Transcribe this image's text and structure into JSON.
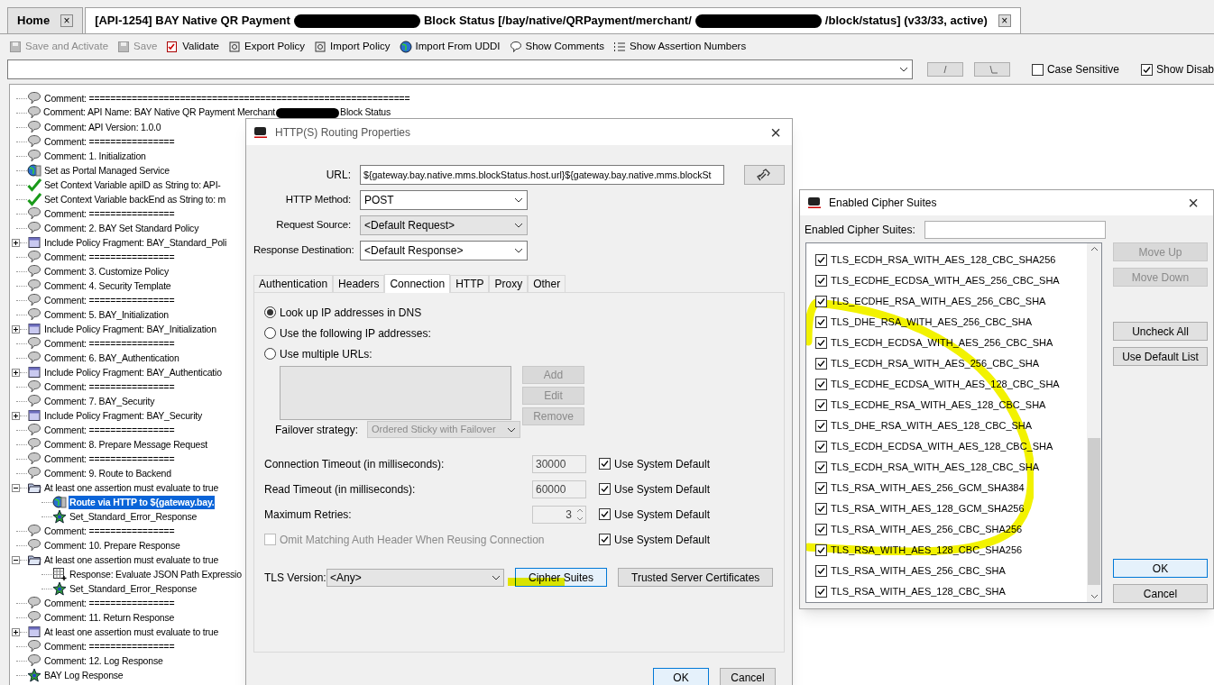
{
  "tabs": [
    {
      "title_parts": [
        "Home"
      ],
      "selected": false,
      "close": "×"
    },
    {
      "title_parts": [
        "[API-1254] BAY Native QR Payment",
        "Block Status [/bay/native/QRPayment/merchant/",
        "/block/status] (v33/33, active)"
      ],
      "selected": true,
      "close": "×"
    }
  ],
  "toolbar": [
    {
      "label": "Save and Activate",
      "kind": "save",
      "disabled": true
    },
    {
      "label": "Save",
      "kind": "save",
      "disabled": true
    },
    {
      "label": "Validate",
      "kind": "validate",
      "disabled": false
    },
    {
      "label": "Export Policy",
      "kind": "export",
      "disabled": false
    },
    {
      "label": "Import Policy",
      "kind": "export",
      "disabled": false
    },
    {
      "label": "Import From UDDI",
      "kind": "globe",
      "disabled": false
    },
    {
      "label": "Show Comments",
      "kind": "comment",
      "disabled": false
    },
    {
      "label": "Show Assertion Numbers",
      "kind": "numbers",
      "disabled": false
    }
  ],
  "search_options": [
    {
      "label": "Case Sensitive",
      "checked": false
    },
    {
      "label": "Show Disab",
      "checked": true
    }
  ],
  "tree": [
    {
      "kind": "comment",
      "text": "Comment: ============================================================",
      "selected": false
    },
    {
      "kind": "comment",
      "parts": [
        "Comment: API Name: BAY Native QR Payment Merchant",
        "Block Status"
      ],
      "selected": false
    },
    {
      "kind": "comment",
      "text": "Comment: API Version: 1.0.0",
      "selected": false
    },
    {
      "kind": "comment",
      "text": "Comment: ================",
      "selected": false
    },
    {
      "kind": "comment",
      "text": "Comment: 1. Initialization",
      "selected": false
    },
    {
      "kind": "globe",
      "text": "Set as Portal Managed Service",
      "selected": false
    },
    {
      "kind": "check",
      "text": "Set Context Variable apiID as String to: API-",
      "selected": false
    },
    {
      "kind": "check",
      "text": "Set Context Variable backEnd as String to: m",
      "selected": false
    },
    {
      "kind": "comment",
      "text": "Comment: ================",
      "selected": false
    },
    {
      "kind": "comment",
      "text": "Comment: 2. BAY Set Standard Policy",
      "selected": false
    },
    {
      "kind": "fragment",
      "text": "Include Policy Fragment: BAY_Standard_Poli",
      "selected": false,
      "expanded": false
    },
    {
      "kind": "comment",
      "text": "Comment: ================",
      "selected": false
    },
    {
      "kind": "comment",
      "text": "Comment: 3. Customize Policy",
      "selected": false
    },
    {
      "kind": "comment",
      "text": "Comment: 4. Security Template",
      "selected": false
    },
    {
      "kind": "comment",
      "text": "Comment: ================",
      "selected": false
    },
    {
      "kind": "comment",
      "text": "Comment: 5. BAY_Initialization",
      "selected": false
    },
    {
      "kind": "fragment",
      "text": "Include Policy Fragment: BAY_Initialization",
      "selected": false,
      "expanded": false
    },
    {
      "kind": "comment",
      "text": "Comment: ================",
      "selected": false
    },
    {
      "kind": "comment",
      "text": "Comment: 6. BAY_Authentication",
      "selected": false
    },
    {
      "kind": "fragment",
      "text": "Include Policy Fragment: BAY_Authenticatio",
      "selected": false,
      "expanded": false
    },
    {
      "kind": "comment",
      "text": "Comment: ================",
      "selected": false
    },
    {
      "kind": "comment",
      "text": "Comment: 7. BAY_Security",
      "selected": false
    },
    {
      "kind": "fragment",
      "text": "Include Policy Fragment: BAY_Security",
      "selected": false,
      "expanded": false
    },
    {
      "kind": "comment",
      "text": "Comment: ================",
      "selected": false
    },
    {
      "kind": "comment",
      "text": "Comment: 8. Prepare Message Request",
      "selected": false
    },
    {
      "kind": "comment",
      "text": "Comment: ================",
      "selected": false
    },
    {
      "kind": "comment",
      "text": "Comment: 9. Route to Backend",
      "selected": false
    },
    {
      "kind": "folder",
      "text": "At least one assertion must evaluate to true",
      "selected": false,
      "expanded": true,
      "children": [
        {
          "kind": "globe",
          "text": "Route via HTTP to ${gateway.bay.",
          "selected": true
        },
        {
          "kind": "star",
          "text": "Set_Standard_Error_Response",
          "selected": false
        }
      ]
    },
    {
      "kind": "comment",
      "text": "Comment: ================",
      "selected": false
    },
    {
      "kind": "comment",
      "text": "Comment: 10. Prepare Response",
      "selected": false
    },
    {
      "kind": "folder",
      "text": "At least one assertion must evaluate to true",
      "selected": false,
      "expanded": true,
      "children": [
        {
          "kind": "json",
          "text": "Response: Evaluate JSON Path Expressio",
          "selected": false
        },
        {
          "kind": "star",
          "text": "Set_Standard_Error_Response",
          "selected": false
        }
      ]
    },
    {
      "kind": "comment",
      "text": "Comment: ================",
      "selected": false
    },
    {
      "kind": "comment",
      "text": "Comment: 11. Return Response",
      "selected": false
    },
    {
      "kind": "fragment",
      "text": "At least one assertion must evaluate to true",
      "selected": false,
      "expanded": false
    },
    {
      "kind": "comment",
      "text": "Comment: ================",
      "selected": false
    },
    {
      "kind": "comment",
      "text": "Comment: 12. Log Response",
      "selected": false
    },
    {
      "kind": "star",
      "text": "BAY Log Response",
      "selected": false
    }
  ],
  "http_dialog": {
    "title": "HTTP(S) Routing Properties",
    "close": "×",
    "url": {
      "label": "URL:",
      "value": "${gateway.bay.native.mms.blockStatus.host.url}${gateway.bay.native.mms.blockSt"
    },
    "fields": [
      {
        "label": "HTTP Method:",
        "value": "POST",
        "disabled": false
      },
      {
        "label": "Request Source:",
        "value": "<Default Request>",
        "disabled": true
      },
      {
        "label": "Response Destination:",
        "value": "<Default Response>",
        "disabled": false
      }
    ],
    "tabs": [
      {
        "label": "Authentication",
        "selected": false
      },
      {
        "label": "Headers",
        "selected": false
      },
      {
        "label": "Connection",
        "selected": true
      },
      {
        "label": "HTTP",
        "selected": false
      },
      {
        "label": "Proxy",
        "selected": false
      },
      {
        "label": "Other",
        "selected": false
      }
    ],
    "radios": [
      {
        "label": "Look up IP addresses in DNS",
        "selected": true
      },
      {
        "label": "Use the following IP addresses:",
        "selected": false
      },
      {
        "label": "Use multiple URLs:",
        "selected": false
      }
    ],
    "list_buttons": [
      {
        "label": "Add",
        "disabled": true
      },
      {
        "label": "Edit",
        "disabled": true
      },
      {
        "label": "Remove",
        "disabled": true
      }
    ],
    "failover": {
      "label": "Failover strategy:",
      "value": "Ordered Sticky with Failover",
      "disabled": true
    },
    "settings": [
      {
        "kind": "input",
        "label": "Connection Timeout (in milliseconds):",
        "value": "30000",
        "disabled": true,
        "default_label": "Use System Default",
        "default_checked": true
      },
      {
        "kind": "input",
        "label": "Read Timeout (in milliseconds):",
        "value": "60000",
        "disabled": true,
        "default_label": "Use System Default",
        "default_checked": true
      },
      {
        "kind": "spinner",
        "label": "Maximum Retries:",
        "value": "3",
        "disabled": true,
        "default_label": "Use System Default",
        "default_checked": true
      },
      {
        "kind": "checkbox",
        "label": "Omit Matching Auth Header When Reusing Connection",
        "checked": false,
        "disabled": true,
        "default_label": "Use System Default",
        "default_checked": true
      }
    ],
    "tls": {
      "label": "TLS Version:",
      "value": "<Any>"
    },
    "tls_buttons": [
      {
        "label": "Cipher Suites",
        "focused": true
      },
      {
        "label": "Trusted Server Certificates",
        "focused": false
      }
    ],
    "footer_buttons": [
      {
        "label": "OK",
        "focused": true
      },
      {
        "label": "Cancel",
        "focused": false
      }
    ]
  },
  "cipher_dialog": {
    "title": "Enabled Cipher Suites",
    "close": "×",
    "filter_label": "Enabled Cipher Suites:",
    "suites": [
      {
        "label": "TLS_ECDH_RSA_WITH_AES_128_CBC_SHA256",
        "checked": true
      },
      {
        "label": "TLS_ECDHE_ECDSA_WITH_AES_256_CBC_SHA",
        "checked": true
      },
      {
        "label": "TLS_ECDHE_RSA_WITH_AES_256_CBC_SHA",
        "checked": true
      },
      {
        "label": "TLS_DHE_RSA_WITH_AES_256_CBC_SHA",
        "checked": true
      },
      {
        "label": "TLS_ECDH_ECDSA_WITH_AES_256_CBC_SHA",
        "checked": true
      },
      {
        "label": "TLS_ECDH_RSA_WITH_AES_256_CBC_SHA",
        "checked": true
      },
      {
        "label": "TLS_ECDHE_ECDSA_WITH_AES_128_CBC_SHA",
        "checked": true
      },
      {
        "label": "TLS_ECDHE_RSA_WITH_AES_128_CBC_SHA",
        "checked": true
      },
      {
        "label": "TLS_DHE_RSA_WITH_AES_128_CBC_SHA",
        "checked": true
      },
      {
        "label": "TLS_ECDH_ECDSA_WITH_AES_128_CBC_SHA",
        "checked": true
      },
      {
        "label": "TLS_ECDH_RSA_WITH_AES_128_CBC_SHA",
        "checked": true
      },
      {
        "label": "TLS_RSA_WITH_AES_256_GCM_SHA384",
        "checked": true
      },
      {
        "label": "TLS_RSA_WITH_AES_128_GCM_SHA256",
        "checked": true
      },
      {
        "label": "TLS_RSA_WITH_AES_256_CBC_SHA256",
        "checked": true
      },
      {
        "label": "TLS_RSA_WITH_AES_128_CBC_SHA256",
        "checked": true
      },
      {
        "label": "TLS_RSA_WITH_AES_256_CBC_SHA",
        "checked": true
      },
      {
        "label": "TLS_RSA_WITH_AES_128_CBC_SHA",
        "checked": true
      }
    ],
    "side_buttons": [
      {
        "label": "Move Up",
        "disabled": true
      },
      {
        "label": "Move Down",
        "disabled": true
      },
      {
        "label": "Uncheck All",
        "disabled": false
      },
      {
        "label": "Use Default List",
        "disabled": false
      }
    ],
    "footer_buttons": [
      {
        "label": "OK",
        "focused": true
      },
      {
        "label": "Cancel",
        "focused": false
      }
    ]
  }
}
